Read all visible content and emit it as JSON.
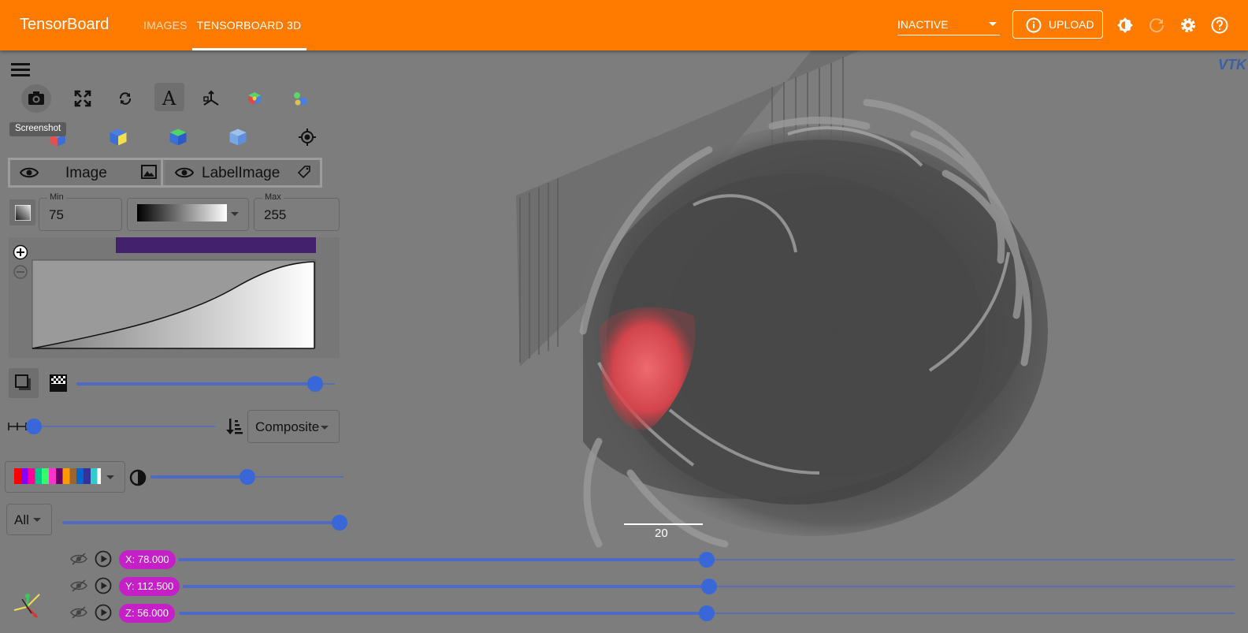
{
  "app": {
    "title": "TensorBoard"
  },
  "tabs": [
    {
      "label": "Images"
    },
    {
      "label": "TensorBoard 3D"
    }
  ],
  "run_select": {
    "value": "INACTIVE"
  },
  "upload": {
    "label": "UPLOAD"
  },
  "toolbar": {
    "tooltip": "Screenshot"
  },
  "layers": [
    {
      "label": "Image"
    },
    {
      "label": "LabelImage"
    }
  ],
  "range": {
    "min_label": "Min",
    "min_value": "75",
    "max_label": "Max",
    "max_value": "255"
  },
  "opacity": {
    "value": 0.95
  },
  "sample_distance": {
    "value": 0.0
  },
  "blend_mode": {
    "value": "Composite"
  },
  "label_opacity": {
    "value": 0.5
  },
  "label_select": {
    "value": "All"
  },
  "label_slider": {
    "value": 1.0
  },
  "slices": [
    {
      "axis": "X",
      "text": "X: 78.000",
      "fraction": 0.5
    },
    {
      "axis": "Y",
      "text": "Y: 112.500",
      "fraction": 0.5
    },
    {
      "axis": "Z",
      "text": "Z: 56.000",
      "fraction": 0.5
    }
  ],
  "scale_bar": {
    "label": "20"
  },
  "colors": {
    "accent": "#ff7b00",
    "slider": "#3967d8",
    "pill": "#c520c8",
    "label_color": "#e33a45"
  },
  "icons": [
    "menu-icon",
    "screenshot-icon",
    "fullscreen-icon",
    "rotate-icon",
    "annotations-icon",
    "axes-icon",
    "cube-view-icon",
    "lighting-icon",
    "view-x-icon",
    "view-y-icon",
    "view-z-icon",
    "view-iso-icon",
    "reset-camera-icon",
    "eye-icon",
    "image-icon",
    "tag-icon",
    "gradient-icon",
    "shadow-icon",
    "checker-icon",
    "sample-distance-icon",
    "blend-sort-icon",
    "contrast-icon",
    "eye-off-icon",
    "play-icon",
    "orientation-axes-icon",
    "info-icon",
    "brightness-icon",
    "refresh-icon",
    "settings-icon",
    "help-icon"
  ]
}
